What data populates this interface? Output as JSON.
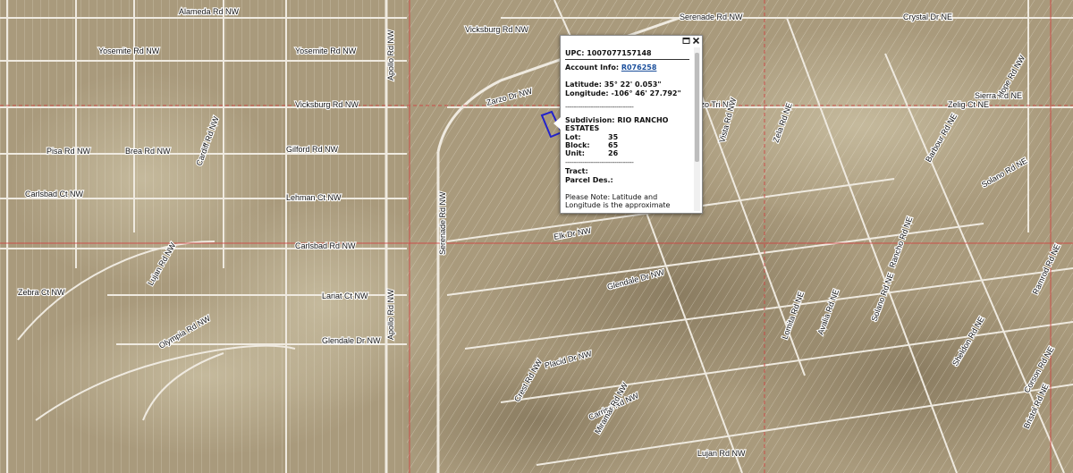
{
  "map": {
    "colors": {
      "terrain": "#a99a7c",
      "road": "#efeae0",
      "boundary": "#d04040",
      "selected_parcel": "#2222cc"
    },
    "road_labels": [
      "Alameda Rd NW",
      "Yosemite Rd NW",
      "Yosemite Rd NW",
      "Vicksburg Rd NW",
      "Vicksburg Rd NW",
      "Pisa Rd NW",
      "Brea Rd NW",
      "Gilford Rd NW",
      "Carlsbad Ct NW",
      "Lehman Ct NW",
      "Carlsbad Rd NW",
      "Cardiff Rd NW",
      "Lariat Ct NW",
      "Glendale Dr NW",
      "Apollo Rd NW",
      "Apollo Rd NW",
      "Zarzo Dr NW",
      "Serenade Rd NW",
      "Serenade Rd NW",
      "Crystal Dr NE",
      "Zarzo Tri NW",
      "Vista Rd NW",
      "Amer Dr NW",
      "Elk Dr NW",
      "Glendale Dr NW",
      "Placid Dr NW",
      "Olympia Rd NW",
      "Zelig Ct NE",
      "Barbour Rd NE",
      "Rancho Rd NE",
      "Solano Rd NE",
      "Ramrod Rd NE",
      "Sheldon Rd NE",
      "Corson Rd NE",
      "Avalia Rd NE",
      "Lomita Rd NE",
      "Carrisa Rd NW",
      "Crest Rd NW",
      "Miramar Rd NW",
      "Bristol Rd NE",
      "Sierra Rd NE",
      "Solano Rd NE",
      "Zela Rd NE",
      "Zebra Ct NW",
      "Lujan Rd NW",
      "Lujan Rd NW",
      "Hope Rd NW"
    ]
  },
  "popup": {
    "upc_label": "UPC:",
    "upc_value": "1007077157148",
    "account_label": "Account Info:",
    "account_value": "R076258",
    "latitude_label": "Latitude:",
    "latitude_value": "35° 22' 0.053\"",
    "longitude_label": "Longitude:",
    "longitude_value": "-106° 46' 27.792\"",
    "separator": "--------------------------------",
    "subdivision_label": "Subdivision:",
    "subdivision_value": "RIO RANCHO ESTATES",
    "lot_label": "Lot:",
    "lot_value": "35",
    "block_label": "Block:",
    "block_value": "65",
    "unit_label": "Unit:",
    "unit_value": "26",
    "tract_label": "Tract:",
    "parcel_des_label": "Parcel Des.:",
    "note": "Please Note: Latitude and Longitude is the approximate center of the parcel shown."
  }
}
